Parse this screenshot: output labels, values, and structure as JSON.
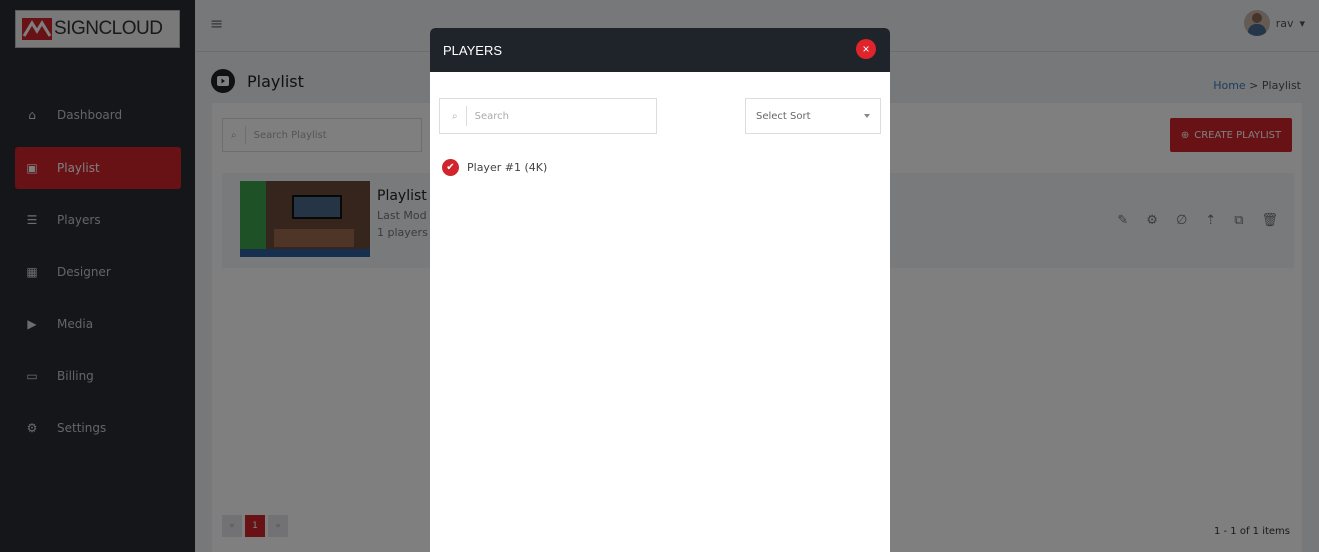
{
  "brand": {
    "logo_text": "SIGNCLOUD"
  },
  "sidebar": {
    "items": [
      {
        "label": "Dashboard",
        "icon": "home-icon"
      },
      {
        "label": "Playlist",
        "icon": "playlist-icon",
        "active": true
      },
      {
        "label": "Players",
        "icon": "list-icon"
      },
      {
        "label": "Designer",
        "icon": "grid-icon"
      },
      {
        "label": "Media",
        "icon": "play-icon"
      },
      {
        "label": "Billing",
        "icon": "money-icon"
      },
      {
        "label": "Settings",
        "icon": "gear-icon"
      }
    ]
  },
  "header": {
    "username": "rav"
  },
  "page": {
    "title": "Playlist",
    "breadcrumb_home": "Home",
    "breadcrumb_sep": ">",
    "breadcrumb_current": "Playlist"
  },
  "content": {
    "search_placeholder": "Search Playlist",
    "create_label": "CREATE PLAYLIST",
    "row": {
      "title": "Playlist",
      "sub1": "Last Mod",
      "sub2": "1 players"
    },
    "pager": {
      "prev": "«",
      "current": "1",
      "next": "»"
    },
    "count": "1 - 1 of 1 items"
  },
  "modal": {
    "title": "PLAYERS",
    "close": "×",
    "search_placeholder": "Search",
    "sort_label": "Select Sort",
    "players": [
      {
        "label": "Player #1 (4K)",
        "checked": true
      }
    ]
  },
  "colors": {
    "accent": "#d0252c",
    "sidebar": "#2a2d33",
    "modal_header": "#1f232a"
  }
}
